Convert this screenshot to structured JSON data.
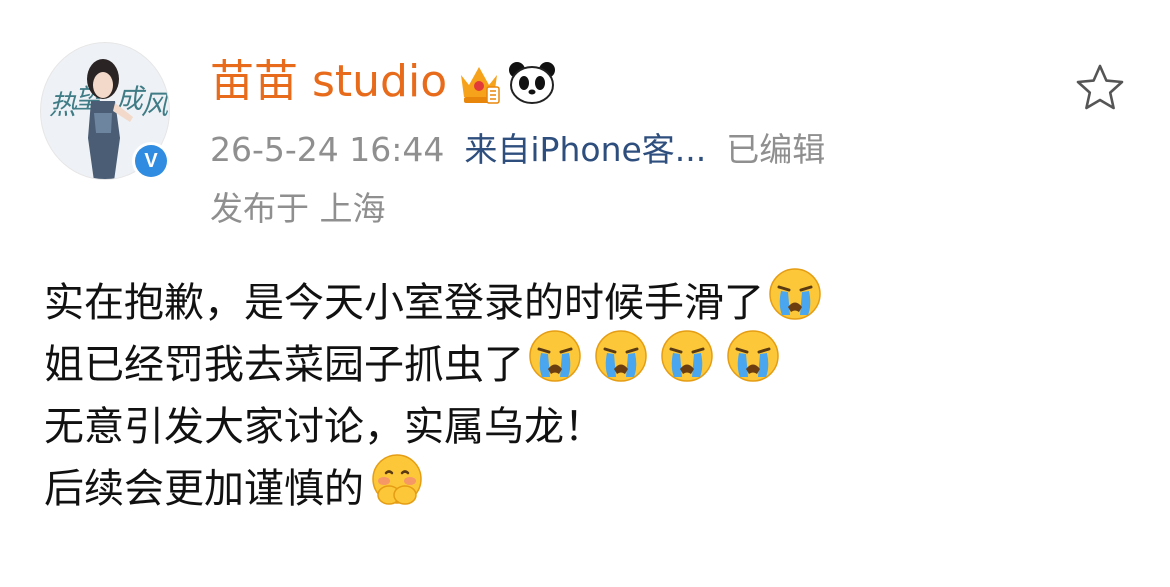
{
  "post": {
    "author": {
      "name": "苗苗 studio",
      "avatar_text": [
        "热",
        "望",
        "成",
        "风"
      ],
      "verified_mark": "V"
    },
    "meta": {
      "time": "26-5-24 16:44",
      "source": "来自iPhone客...",
      "edited": "已编辑",
      "location": "发布于 上海"
    },
    "lines": [
      {
        "text": "实在抱歉，是今天小室登录的时候手滑了",
        "emojis": [
          "crying-emoji"
        ]
      },
      {
        "text": "姐已经罚我去菜园子抓虫了",
        "emojis": [
          "crying-emoji",
          "crying-emoji",
          "crying-emoji",
          "crying-emoji"
        ]
      },
      {
        "text": "无意引发大家讨论，实属乌龙！",
        "emojis": []
      },
      {
        "text": "后续会更加谨慎的",
        "emojis": [
          "blushing-hands-emoji"
        ]
      }
    ]
  },
  "colors": {
    "name": "#e86b1b",
    "meta": "#8f8f8f",
    "source_link": "#2e4e7e",
    "verified": "#2f8ce0",
    "body": "#111111"
  },
  "icons": [
    "crown-badge-icon",
    "panda-icon",
    "verified-icon",
    "star-icon",
    "crying-emoji",
    "blushing-hands-emoji"
  ]
}
